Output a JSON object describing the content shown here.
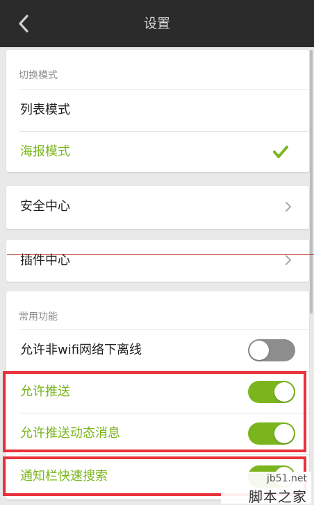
{
  "header": {
    "title": "设置"
  },
  "mode_section": {
    "label": "切换模式",
    "options": [
      {
        "label": "列表模式",
        "selected": false
      },
      {
        "label": "海报模式",
        "selected": true
      }
    ]
  },
  "security": {
    "label": "安全中心"
  },
  "plugins": {
    "label": "插件中心"
  },
  "common_section": {
    "label": "常用功能",
    "toggles": [
      {
        "label": "允许非wifi网络下离线",
        "on": false
      },
      {
        "label": "允许推送",
        "on": true
      },
      {
        "label": "允许推送动态消息",
        "on": true
      },
      {
        "label": "通知栏快速搜索",
        "on": true
      }
    ]
  },
  "watermark": {
    "url": "jb51.net",
    "name": "脚本之家"
  },
  "colors": {
    "accent": "#7ab51d",
    "topbar": "#2b2b2b",
    "highlight": "#e8323c"
  }
}
